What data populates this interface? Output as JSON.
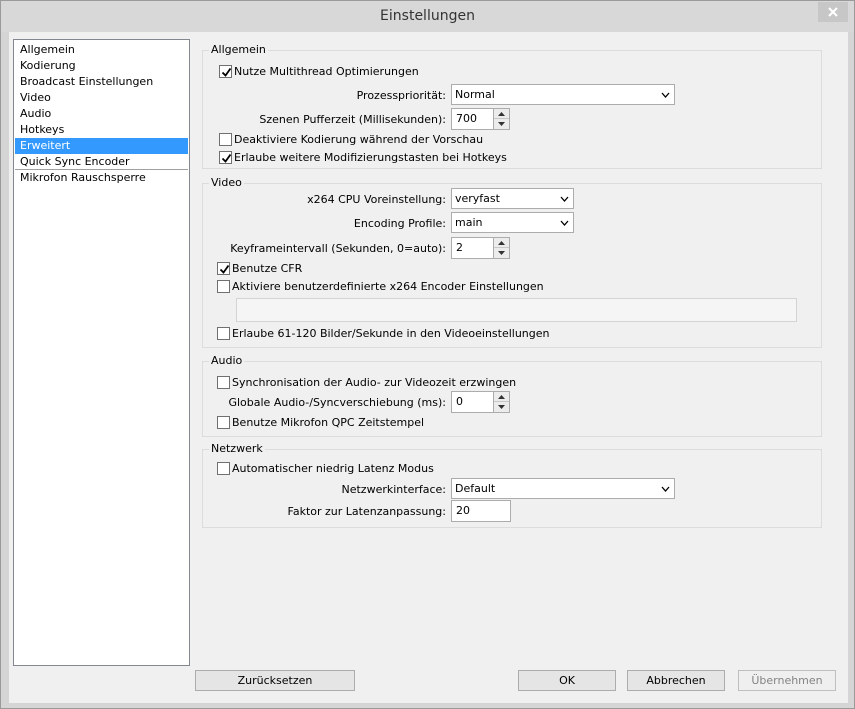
{
  "window": {
    "title": "Einstellungen"
  },
  "sidebar": {
    "items": [
      {
        "label": "Allgemein"
      },
      {
        "label": "Kodierung"
      },
      {
        "label": "Broadcast Einstellungen"
      },
      {
        "label": "Video"
      },
      {
        "label": "Audio"
      },
      {
        "label": "Hotkeys"
      },
      {
        "label": "Erweitert",
        "selected": true
      },
      {
        "label": "Quick Sync Encoder"
      },
      {
        "label": "Mikrofon Rauschsperre"
      }
    ]
  },
  "allgemein": {
    "title": "Allgemein",
    "multithread": {
      "label": "Nutze Multithread Optimierungen",
      "checked": true
    },
    "priority": {
      "label": "Prozesspriorität:",
      "value": "Normal"
    },
    "buffer": {
      "label": "Szenen Pufferzeit (Millisekunden):",
      "value": "700"
    },
    "disable_encoding": {
      "label": "Deaktiviere Kodierung während der Vorschau",
      "checked": false
    },
    "modifier_keys": {
      "label": "Erlaube weitere Modifizierungstasten bei Hotkeys",
      "checked": true
    }
  },
  "video": {
    "title": "Video",
    "preset": {
      "label": "x264 CPU Voreinstellung:",
      "value": "veryfast"
    },
    "profile": {
      "label": "Encoding Profile:",
      "value": "main"
    },
    "keyframe": {
      "label": "Keyframeintervall (Sekunden, 0=auto):",
      "value": "2"
    },
    "cfr": {
      "label": "Benutze CFR",
      "checked": true
    },
    "custom_x264": {
      "label": "Aktiviere benutzerdefinierte x264 Encoder Einstellungen",
      "checked": false
    },
    "custom_x264_value": "",
    "fps_high": {
      "label": "Erlaube 61-120 Bilder/Sekunde in den Videoeinstellungen",
      "checked": false
    }
  },
  "audio": {
    "title": "Audio",
    "sync": {
      "label": "Synchronisation der Audio- zur Videozeit erzwingen",
      "checked": false
    },
    "offset": {
      "label": "Globale Audio-/Syncverschiebung (ms):",
      "value": "0"
    },
    "qpc": {
      "label": "Benutze Mikrofon QPC Zeitstempel",
      "checked": false
    }
  },
  "netzwerk": {
    "title": "Netzwerk",
    "low_latency": {
      "label": "Automatischer niedrig Latenz Modus",
      "checked": false
    },
    "interface": {
      "label": "Netzwerkinterface:",
      "value": "Default"
    },
    "latency_factor": {
      "label": "Faktor zur Latenzanpassung:",
      "value": "20"
    }
  },
  "buttons": {
    "reset": "Zurücksetzen",
    "ok": "OK",
    "cancel": "Abbrechen",
    "apply": "Übernehmen"
  },
  "colors": {
    "selection": "#3399ff",
    "window_bg": "#f0f0f0",
    "titlebar_bg": "#d8d8d8"
  },
  "icons": [
    "close-icon",
    "check-icon",
    "chevron-down-icon",
    "spin-up-icon",
    "spin-down-icon"
  ]
}
